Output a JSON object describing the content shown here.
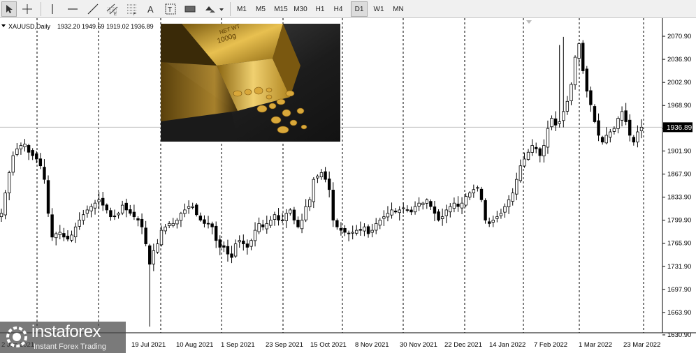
{
  "toolbar": {
    "tools": [
      {
        "name": "cursor-tool-icon"
      },
      {
        "name": "crosshair-tool-icon"
      },
      {
        "name": "vertical-line-tool-icon"
      },
      {
        "name": "horizontal-line-tool-icon"
      },
      {
        "name": "trendline-tool-icon"
      },
      {
        "name": "equidistant-channel-tool-icon"
      },
      {
        "name": "fibonacci-tool-icon"
      },
      {
        "name": "text-tool-icon",
        "glyph": "A"
      },
      {
        "name": "text-label-tool-icon",
        "glyph": "T"
      },
      {
        "name": "rectangle-tool-icon"
      },
      {
        "name": "shapes-dropdown-icon"
      }
    ],
    "timeframes": [
      "M1",
      "M5",
      "M15",
      "M30",
      "H1",
      "H4",
      "D1",
      "W1",
      "MN"
    ],
    "active_timeframe": "D1"
  },
  "chart_info": {
    "symbol": "XAUUSD,Daily",
    "ohlc": "1932.20 1949.69 1919.02 1936.89"
  },
  "current_price": "1936.89",
  "chart_data": {
    "type": "candlestick",
    "symbol": "XAUUSD",
    "timeframe": "Daily",
    "ylim": [
      1620,
      2090
    ],
    "y_ticks": [
      2070.9,
      2036.9,
      2002.9,
      1968.9,
      1934.9,
      1901.9,
      1867.9,
      1833.9,
      1799.9,
      1765.9,
      1731.9,
      1697.9,
      1663.9,
      1630.9
    ],
    "x_labels": [
      "2 Jun 2021",
      "19 Jul 2021",
      "10 Aug 2021",
      "1 Sep 2021",
      "23 Sep 2021",
      "15 Oct 2021",
      "8 Nov 2021",
      "30 Nov 2021",
      "22 Dec 2021",
      "14 Jan 2022",
      "7 Feb 2022",
      "1 Mar 2022",
      "23 Mar 2022"
    ],
    "close_path": [
      1810,
      1840,
      1870,
      1895,
      1905,
      1910,
      1912,
      1900,
      1895,
      1890,
      1880,
      1860,
      1810,
      1775,
      1780,
      1782,
      1775,
      1772,
      1778,
      1790,
      1800,
      1808,
      1815,
      1820,
      1825,
      1830,
      1822,
      1815,
      1805,
      1805,
      1810,
      1822,
      1815,
      1810,
      1805,
      1800,
      1790,
      1765,
      1735,
      1755,
      1765,
      1785,
      1790,
      1795,
      1795,
      1800,
      1810,
      1815,
      1820,
      1820,
      1808,
      1800,
      1795,
      1795,
      1790,
      1770,
      1760,
      1760,
      1750,
      1745,
      1765,
      1770,
      1765,
      1760,
      1770,
      1785,
      1795,
      1790,
      1795,
      1800,
      1808,
      1800,
      1800,
      1810,
      1815,
      1800,
      1790,
      1800,
      1820,
      1830,
      1860,
      1865,
      1870,
      1860,
      1845,
      1800,
      1790,
      1785,
      1782,
      1780,
      1782,
      1785,
      1785,
      1790,
      1780,
      1785,
      1795,
      1800,
      1805,
      1810,
      1815,
      1812,
      1815,
      1818,
      1815,
      1812,
      1820,
      1825,
      1825,
      1830,
      1820,
      1810,
      1800,
      1805,
      1815,
      1820,
      1825,
      1820,
      1825,
      1835,
      1840,
      1845,
      1848,
      1830,
      1800,
      1795,
      1800,
      1805,
      1810,
      1820,
      1830,
      1840,
      1860,
      1880,
      1890,
      1900,
      1910,
      1905,
      1895,
      1910,
      1935,
      1950,
      1940,
      1945,
      1960,
      1975,
      2000,
      2040,
      2060,
      2020,
      1990,
      1970,
      1945,
      1925,
      1915,
      1925,
      1930,
      1935,
      1950,
      1960,
      1945,
      1925,
      1915,
      1930,
      1936.89
    ]
  },
  "photo": {
    "inscription": "NET WT\n1000g",
    "alt": "gold bar photo"
  },
  "watermark": {
    "brand": "instaforex",
    "tagline": "Instant Forex Trading"
  },
  "colors": {
    "grid_vline": "#000000",
    "price_line": "#c0c0c0",
    "candle": "#000000",
    "price_tag_bg": "#000000",
    "price_tag_fg": "#ffffff"
  }
}
